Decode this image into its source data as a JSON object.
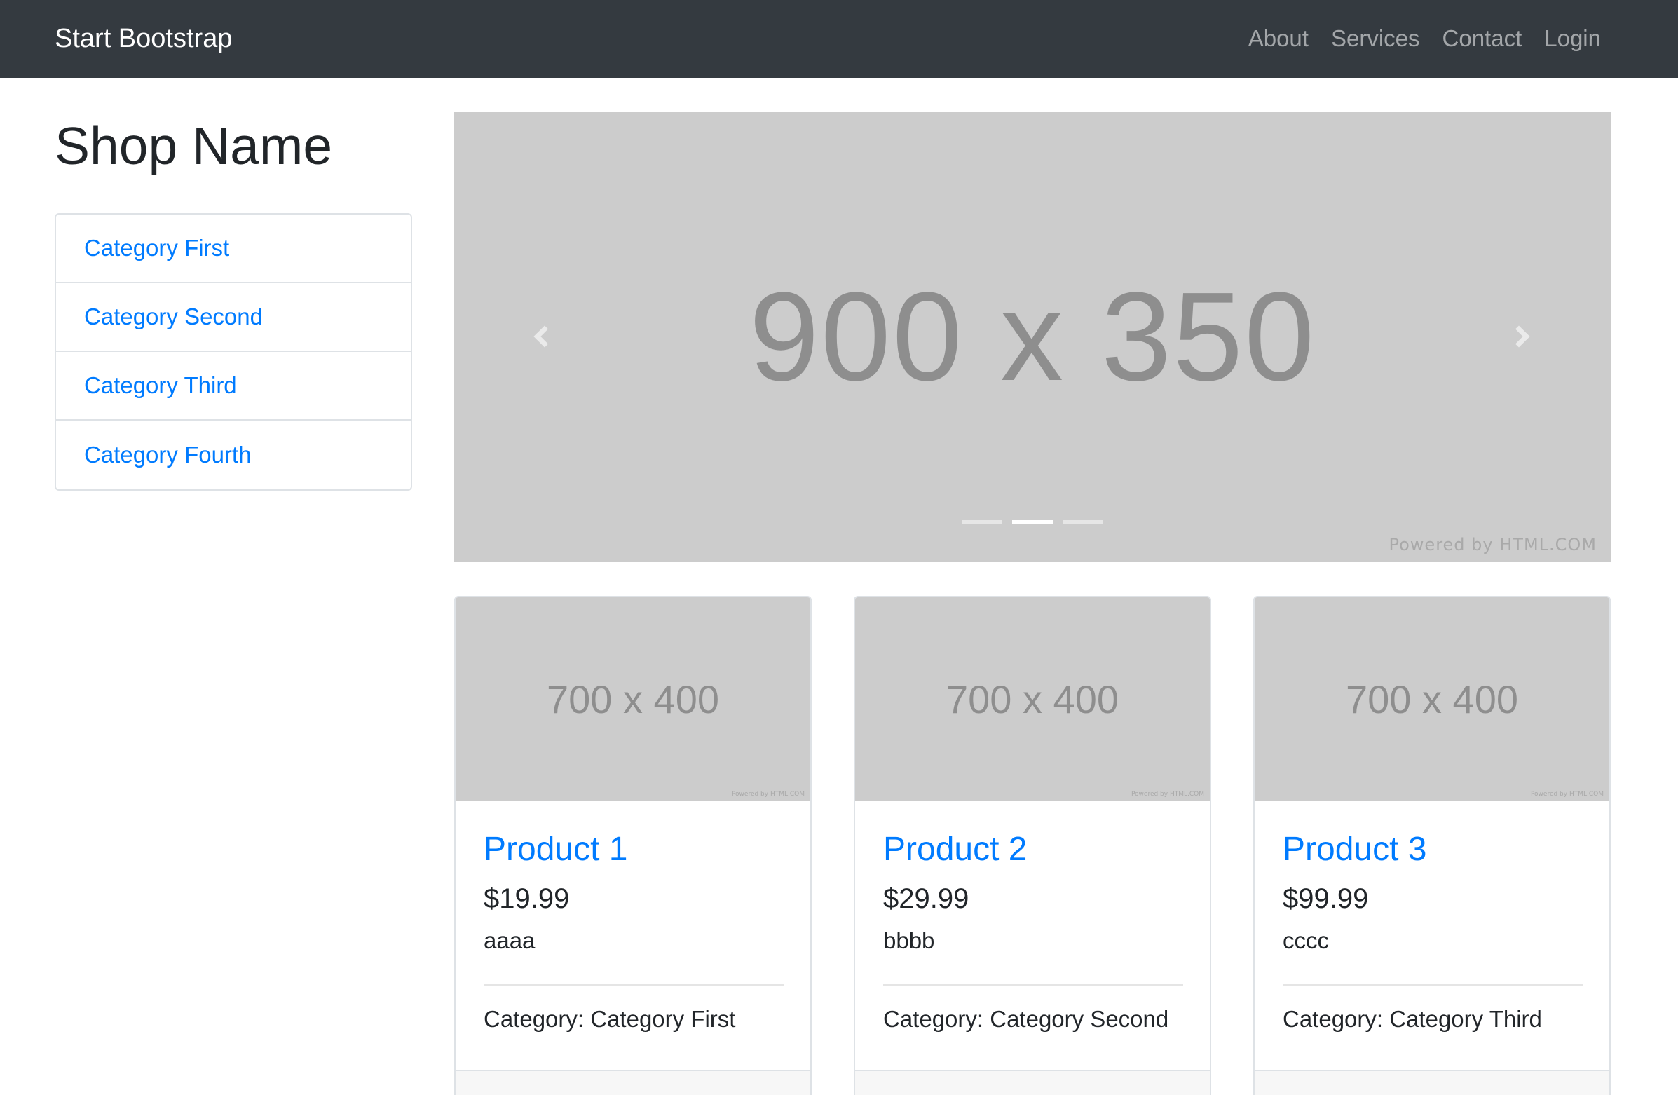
{
  "navbar": {
    "brand": "Start Bootstrap",
    "links": [
      "About",
      "Services",
      "Contact",
      "Login"
    ]
  },
  "sidebar": {
    "shop_name": "Shop Name",
    "categories": [
      "Category First",
      "Category Second",
      "Category Third",
      "Category Fourth"
    ]
  },
  "carousel": {
    "image_label": "900 x 350",
    "watermark": "Powered by HTML.COM",
    "slide_count": 3,
    "active_slide": 2,
    "prev_icon": "chevron-left-icon",
    "next_icon": "chevron-right-icon"
  },
  "products": [
    {
      "image_label": "700 x 400",
      "watermark": "Powered by HTML.COM",
      "title": "Product 1",
      "price": "$19.99",
      "description": "aaaa",
      "category": "Category: Category First"
    },
    {
      "image_label": "700 x 400",
      "watermark": "Powered by HTML.COM",
      "title": "Product 2",
      "price": "$29.99",
      "description": "bbbb",
      "category": "Category: Category Second"
    },
    {
      "image_label": "700 x 400",
      "watermark": "Powered by HTML.COM",
      "title": "Product 3",
      "price": "$99.99",
      "description": "cccc",
      "category": "Category: Category Third"
    }
  ],
  "colors": {
    "navbar_bg": "#343a40",
    "link": "#007bff",
    "placeholder_bg": "#cccccc",
    "placeholder_text": "#8e8e8e"
  }
}
